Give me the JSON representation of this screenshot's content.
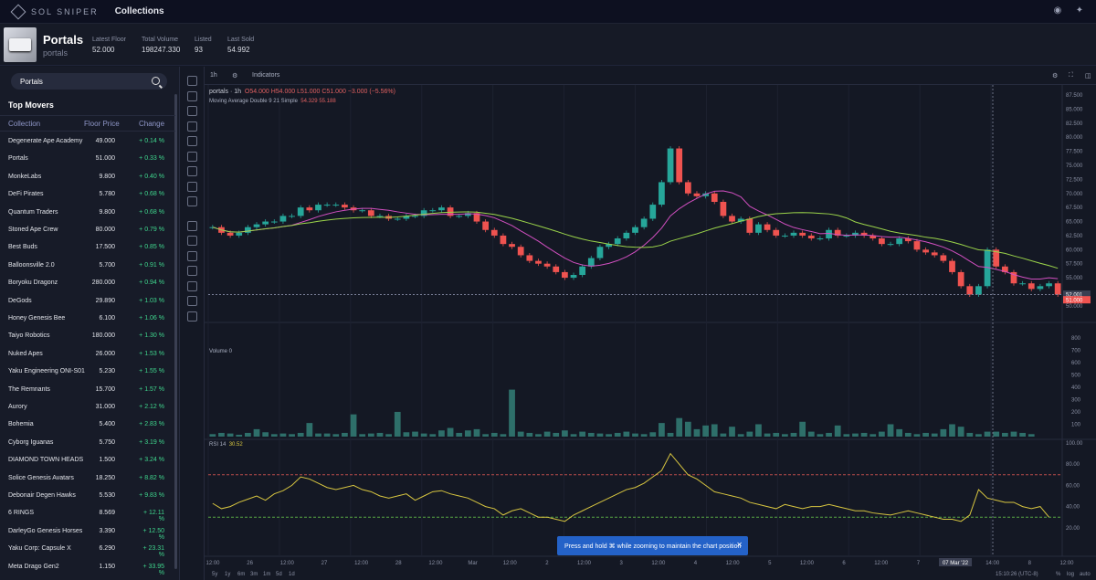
{
  "brand": {
    "name": "SOL SNIPER",
    "nav": "Collections"
  },
  "collection": {
    "name": "Portals",
    "slug": "portals",
    "stats": [
      {
        "label": "Latest Floor",
        "value": "52.000"
      },
      {
        "label": "Total Volume",
        "value": "198247.330"
      },
      {
        "label": "Listed",
        "value": "93"
      },
      {
        "label": "Last Sold",
        "value": "54.992"
      }
    ]
  },
  "sidebar": {
    "search_value": "Portals",
    "top_movers_title": "Top Movers",
    "columns": [
      "Collection",
      "Floor Price",
      "Change"
    ],
    "rows": [
      [
        "Degenerate Ape Academy",
        "49.000",
        "+ 0.14 %"
      ],
      [
        "Portals",
        "51.000",
        "+ 0.33 %"
      ],
      [
        "MonkeLabs",
        "9.800",
        "+ 0.40 %"
      ],
      [
        "DeFi Pirates",
        "5.780",
        "+ 0.68 %"
      ],
      [
        "Quantum Traders",
        "9.800",
        "+ 0.68 %"
      ],
      [
        "Stoned Ape Crew",
        "80.000",
        "+ 0.79 %"
      ],
      [
        "Best Buds",
        "17.500",
        "+ 0.85 %"
      ],
      [
        "Balloonsville 2.0",
        "5.700",
        "+ 0.91 %"
      ],
      [
        "Boryoku Dragonz",
        "280.000",
        "+ 0.94 %"
      ],
      [
        "DeGods",
        "29.890",
        "+ 1.03 %"
      ],
      [
        "Honey Genesis Bee",
        "6.100",
        "+ 1.06 %"
      ],
      [
        "Taiyo Robotics",
        "180.000",
        "+ 1.30 %"
      ],
      [
        "Nuked Apes",
        "26.000",
        "+ 1.53 %"
      ],
      [
        "Yaku Engineering ONI-S01",
        "5.230",
        "+ 1.55 %"
      ],
      [
        "The Remnants",
        "15.700",
        "+ 1.57 %"
      ],
      [
        "Aurory",
        "31.000",
        "+ 2.12 %"
      ],
      [
        "Bohemia",
        "5.400",
        "+ 2.83 %"
      ],
      [
        "Cyborg Iguanas",
        "5.750",
        "+ 3.19 %"
      ],
      [
        "DIAMOND TOWN HEADS",
        "1.500",
        "+ 3.24 %"
      ],
      [
        "Solice Genesis Avatars",
        "18.250",
        "+ 8.82 %"
      ],
      [
        "Debonair Degen Hawks",
        "5.530",
        "+ 9.83 %"
      ],
      [
        "6 RINGS",
        "8.569",
        "+ 12.11 %"
      ],
      [
        "DarleyGo Genesis Horses",
        "3.390",
        "+ 12.50 %"
      ],
      [
        "Yaku Corp: Capsule X",
        "6.290",
        "+ 23.31 %"
      ],
      [
        "Meta Drago Gen2",
        "1.150",
        "+ 33.95 %"
      ]
    ]
  },
  "toolbar": {
    "interval": "1h",
    "indicators": "Indicators"
  },
  "legend": {
    "symbol": "portals · 1h",
    "ohlc": "O54.000 H54.000 L51.000 C51.000 −3.000 (−5.56%)",
    "ma": "Moving Average Double 9 21 Simple",
    "ma_vals": "54.329  55.188",
    "volume": "Volume 0",
    "rsi": "RSI 14",
    "rsi_val": "30.52"
  },
  "price_axis": [
    "87.500",
    "85.000",
    "82.500",
    "80.000",
    "77.500",
    "75.000",
    "72.500",
    "70.000",
    "67.500",
    "65.000",
    "62.500",
    "60.000",
    "57.500",
    "55.000",
    "52.001",
    "51.000",
    "50.000"
  ],
  "volume_axis": [
    "800",
    "700",
    "600",
    "500",
    "400",
    "300",
    "200",
    "100"
  ],
  "rsi_axis": [
    "100.00",
    "80.00",
    "60.00",
    "40.00",
    "20.00"
  ],
  "time_axis": [
    "12:00",
    "26",
    "12:00",
    "27",
    "12:00",
    "28",
    "12:00",
    "Mar",
    "12:00",
    "2",
    "12:00",
    "3",
    "12:00",
    "4",
    "12:00",
    "5",
    "12:00",
    "6",
    "12:00",
    "7",
    "07 Mar '22",
    "14:00",
    "8",
    "12:00"
  ],
  "ranges": [
    "5y",
    "1y",
    "6m",
    "3m",
    "1m",
    "5d",
    "1d"
  ],
  "status": {
    "time": "15:10:26 (UTC-8)",
    "pct": "%",
    "log": "log",
    "auto": "auto"
  },
  "toast": {
    "text": "Press and hold ⌘ while zooming to maintain the chart position",
    "close": "✕"
  },
  "chart_data": {
    "type": "candlestick",
    "close": [
      64,
      63,
      62.5,
      63,
      64,
      64.5,
      65,
      65,
      66,
      66,
      67.5,
      67,
      68,
      68,
      68,
      67.5,
      67,
      67,
      66,
      66,
      65.5,
      65.5,
      66,
      66,
      67,
      67,
      67.5,
      66,
      66,
      66.5,
      65,
      63.5,
      62.5,
      61,
      60.5,
      59,
      58,
      57.5,
      57,
      56,
      55,
      55.5,
      57,
      58.5,
      60.5,
      61,
      62,
      63,
      64,
      65.5,
      68,
      72,
      78,
      72,
      70,
      69.5,
      70,
      68.5,
      66,
      65,
      65.5,
      63,
      64.5,
      63.5,
      62.5,
      62.5,
      63,
      62.5,
      62,
      62,
      63.5,
      62.5,
      62.5,
      63,
      62.5,
      62,
      61,
      61,
      62,
      61.5,
      60,
      59.5,
      59,
      58,
      56,
      53.5,
      52,
      53.5,
      60,
      57,
      56,
      54,
      54,
      53,
      53.5,
      54,
      52
    ],
    "volume": [
      20,
      30,
      25,
      15,
      30,
      60,
      35,
      20,
      25,
      20,
      30,
      110,
      25,
      25,
      20,
      30,
      180,
      20,
      25,
      30,
      20,
      200,
      35,
      40,
      25,
      20,
      50,
      70,
      30,
      50,
      60,
      20,
      30,
      20,
      380,
      40,
      30,
      20,
      40,
      30,
      50,
      20,
      40,
      30,
      25,
      20,
      30,
      40,
      25,
      20,
      35,
      110,
      30,
      150,
      120,
      60,
      90,
      100,
      25,
      80,
      20,
      40,
      100,
      25,
      30,
      20,
      30,
      120,
      40,
      20,
      30,
      90,
      20,
      25,
      30,
      20,
      40,
      100,
      60,
      30,
      20,
      30,
      25,
      60,
      100,
      80,
      30,
      20,
      40,
      40,
      30,
      40,
      30,
      20
    ],
    "rsi": [
      43,
      38,
      40,
      44,
      47,
      50,
      46,
      52,
      55,
      60,
      68,
      66,
      62,
      58,
      56,
      58,
      60,
      56,
      54,
      50,
      48,
      50,
      52,
      46,
      50,
      54,
      55,
      52,
      50,
      48,
      44,
      40,
      38,
      32,
      36,
      38,
      34,
      30,
      30,
      28,
      26,
      32,
      36,
      40,
      44,
      48,
      52,
      56,
      58,
      62,
      68,
      74,
      90,
      80,
      70,
      66,
      60,
      54,
      52,
      50,
      48,
      44,
      42,
      40,
      38,
      42,
      40,
      38,
      40,
      40,
      42,
      40,
      38,
      36,
      36,
      34,
      33,
      32,
      34,
      36,
      34,
      32,
      30,
      28,
      28,
      26,
      32,
      56,
      48,
      46,
      44,
      44,
      40,
      38,
      40,
      30
    ]
  }
}
